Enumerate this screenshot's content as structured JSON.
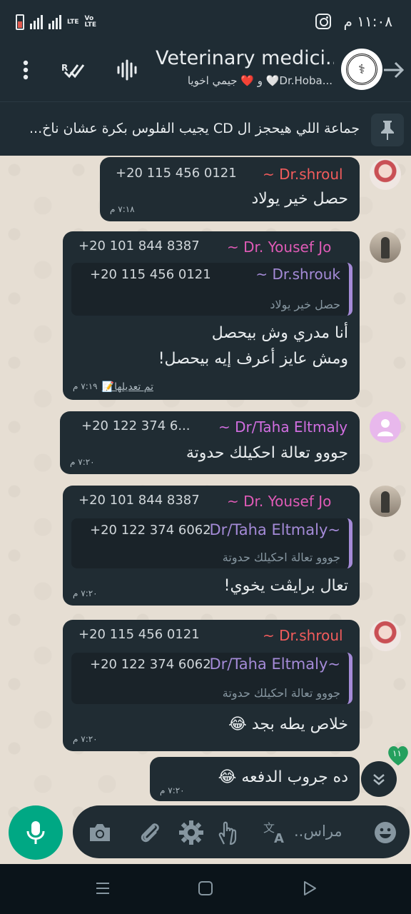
{
  "status": {
    "network": "LTE",
    "volte": "Vo LTE",
    "time": "١١:٠٨ م"
  },
  "header": {
    "title": "Veterinary medici...",
    "subtitle": "...Dr.Hoba🤍 و ❤️ جيمي اخويا"
  },
  "pinned": {
    "text": "جماعة اللي هيحجز ال CD يجيب الفلوس بكرة عشان ناخ..."
  },
  "messages": [
    {
      "name": "~ Dr.shroul",
      "phone": "+20 115 456 0121",
      "text": "حصل خير يولاد",
      "time": "٧:١٨ م",
      "name_color": "#f25c5c"
    },
    {
      "name": "~ Dr. Yousef Jo",
      "phone": "+20 101 844 8387",
      "name_color": "#e05bb7",
      "quote": {
        "name": "~ Dr.shrouk",
        "phone": "+20 115 456 0121",
        "text": "حصل خير يولاد"
      },
      "text_lines": [
        "أنا مدري وش بيحصل",
        "ومش عايز أعرف إيه بيحصل!"
      ],
      "edited": "تم تعديلها📝",
      "time": "٧:١٩ م"
    },
    {
      "name": "~ Dr/Taha Eltmaly",
      "phone": "+20 122 374 6...",
      "text": "جووو تعالة احكيلك حدوتة",
      "time": "٧:٢٠ م",
      "name_color": "#d16ee0"
    },
    {
      "name": "~ Dr. Yousef Jo",
      "phone": "+20 101 844 8387",
      "name_color": "#e05bb7",
      "quote": {
        "name": "Dr/Taha Eltmaly~",
        "phone": "+20 122 374 6062",
        "text": "جووو تعالة احكيلك حدوتة"
      },
      "text": "تعال برايڤت يخوي!",
      "time": "٧:٢٠ م"
    },
    {
      "name": "~ Dr.shroul",
      "phone": "+20 115 456 0121",
      "name_color": "#f25c5c",
      "quote": {
        "name": "Dr/Taha Eltmaly~",
        "phone": "+20 122 374 6062",
        "text": "جووو تعالة احكيلك حدوتة"
      },
      "text": "خلاص يطه بجد 😂",
      "time": "٧:٢٠ م"
    },
    {
      "text": "ده جروب الدفعه 😂",
      "time": "٧:٢٠ م"
    }
  ],
  "badge": {
    "count": "١١"
  },
  "input": {
    "placeholder": "مراس.."
  }
}
